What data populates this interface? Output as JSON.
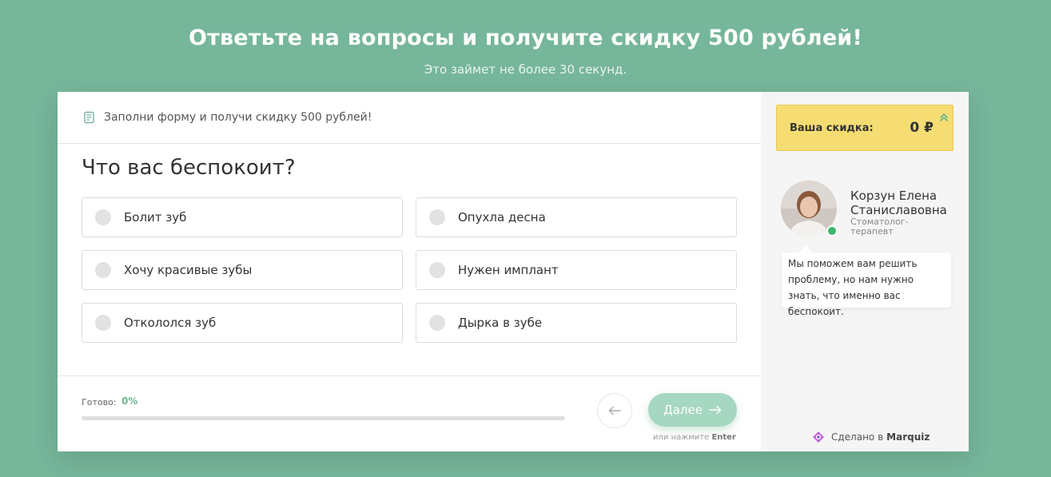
{
  "colors": {
    "background": "#76b69b",
    "accent": "#a6d7c1",
    "progress": "#6bb892",
    "discount_bg": "#f6dd73"
  },
  "hero": {
    "title": "Ответьте на вопросы и получите скидку 500 рублей!",
    "subtitle": "Это займет не более 30 секунд."
  },
  "form": {
    "header_icon": "form-list-icon",
    "header_text": "Заполни форму и получи скидку 500 рублей!",
    "question": "Что вас беспокоит?",
    "options": [
      "Болит зуб",
      "Опухла десна",
      "Хочу красивые зубы",
      "Нужен имплант",
      "Откололся зуб",
      "Дырка в зубе"
    ]
  },
  "footer": {
    "progress_label": "Готово:",
    "progress_value": "0%",
    "progress_fraction": 0,
    "back_icon": "arrow-left-icon",
    "next_label": "Далее",
    "next_icon": "arrow-right-icon",
    "enter_hint_prefix": "или нажмите",
    "enter_hint_key": "Enter"
  },
  "sidebar": {
    "discount_label": "Ваша скидка:",
    "discount_value": "0 ₽",
    "expert_name": "Корзун Елена Станиславовна",
    "expert_role": "Стоматолог-терапевт",
    "message": "Мы поможем вам решить проблему, но нам нужно знать, что именно вас беспокоит.",
    "made_in_prefix": "Сделано в",
    "made_in_brand": "Marquiz"
  }
}
